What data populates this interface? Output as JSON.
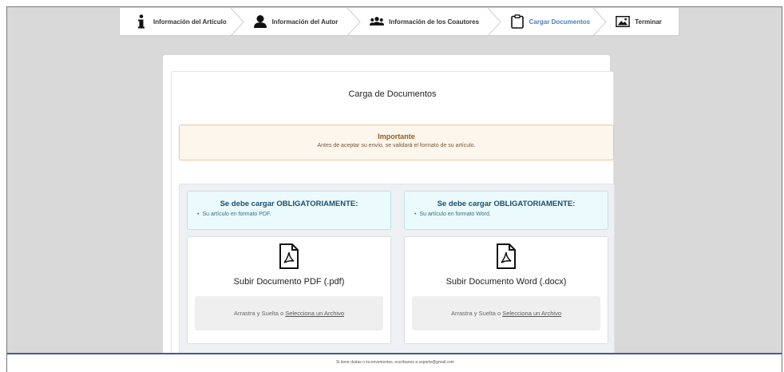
{
  "steps": [
    {
      "label": "Información del Artículo",
      "icon": "info-icon"
    },
    {
      "label": "Información del Autor",
      "icon": "user-icon"
    },
    {
      "label": "Información de los Coautores",
      "icon": "users-icon"
    },
    {
      "label": "Cargar Documentos",
      "icon": "clipboard-icon",
      "active": true
    },
    {
      "label": "Terminar",
      "icon": "image-icon"
    }
  ],
  "page_title": "Carga de Documentos",
  "alert": {
    "title": "Importante",
    "text": "Antes de aceptar su envío, se validará el formato de su artículo."
  },
  "uploads": [
    {
      "requirement_title": "Se debe cargar OBLIGATORIAMENTE:",
      "requirement_item": "Su artículo en formato PDF.",
      "title": "Subir Documento PDF (.pdf)",
      "drop_text": "Arrastra y Suelta o ",
      "drop_link": "Selecciona un Archivo"
    },
    {
      "requirement_title": "Se debe cargar OBLIGATORIAMENTE:",
      "requirement_item": "Su artículo en formato Word.",
      "title": "Subir Documento Word (.docx)",
      "drop_text": "Arrastra y Suelta o ",
      "drop_link": "Selecciona un Archivo"
    }
  ],
  "footer_text": "Si tiene dudas o inconvenientes, escríbanos a soporte@gmail.com",
  "colors": {
    "active_step": "#4a7fc1",
    "alert_bg": "#fcf6ec",
    "info_bg": "#eafafd",
    "footer_border": "#3d5da0"
  }
}
